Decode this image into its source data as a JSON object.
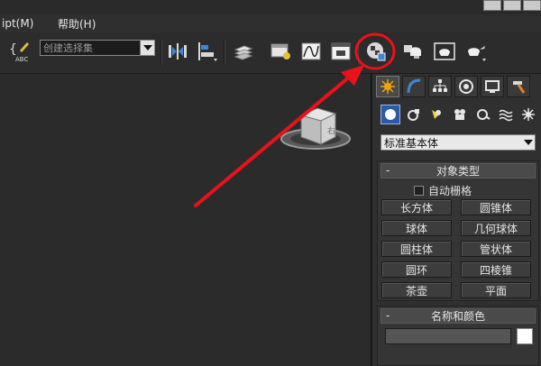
{
  "menu": {
    "items": [
      "ipt(M)",
      "帮助(H)"
    ]
  },
  "toolbar": {
    "selection_set": {
      "value": "创建选择集"
    }
  },
  "command_panel": {
    "category_dropdown": {
      "value": "标准基本体"
    },
    "object_type_rollout": {
      "title": "对象类型",
      "collapse_glyph": "-",
      "autogrid_label": "自动栅格",
      "buttons": [
        "长方体",
        "圆锥体",
        "球体",
        "几何球体",
        "圆柱体",
        "管状体",
        "圆环",
        "四棱锥",
        "茶壶",
        "平面"
      ]
    },
    "name_color_rollout": {
      "title": "名称和颜色",
      "collapse_glyph": "-",
      "color": "#ffffff"
    }
  },
  "viewcube": {
    "face_label": "右"
  },
  "annotation": {
    "color": "#e8121a"
  },
  "colors": {
    "ui_background": "#2b2b2b",
    "active_tool": "#2b5aa8",
    "toolbar": "#2c2c2c"
  }
}
